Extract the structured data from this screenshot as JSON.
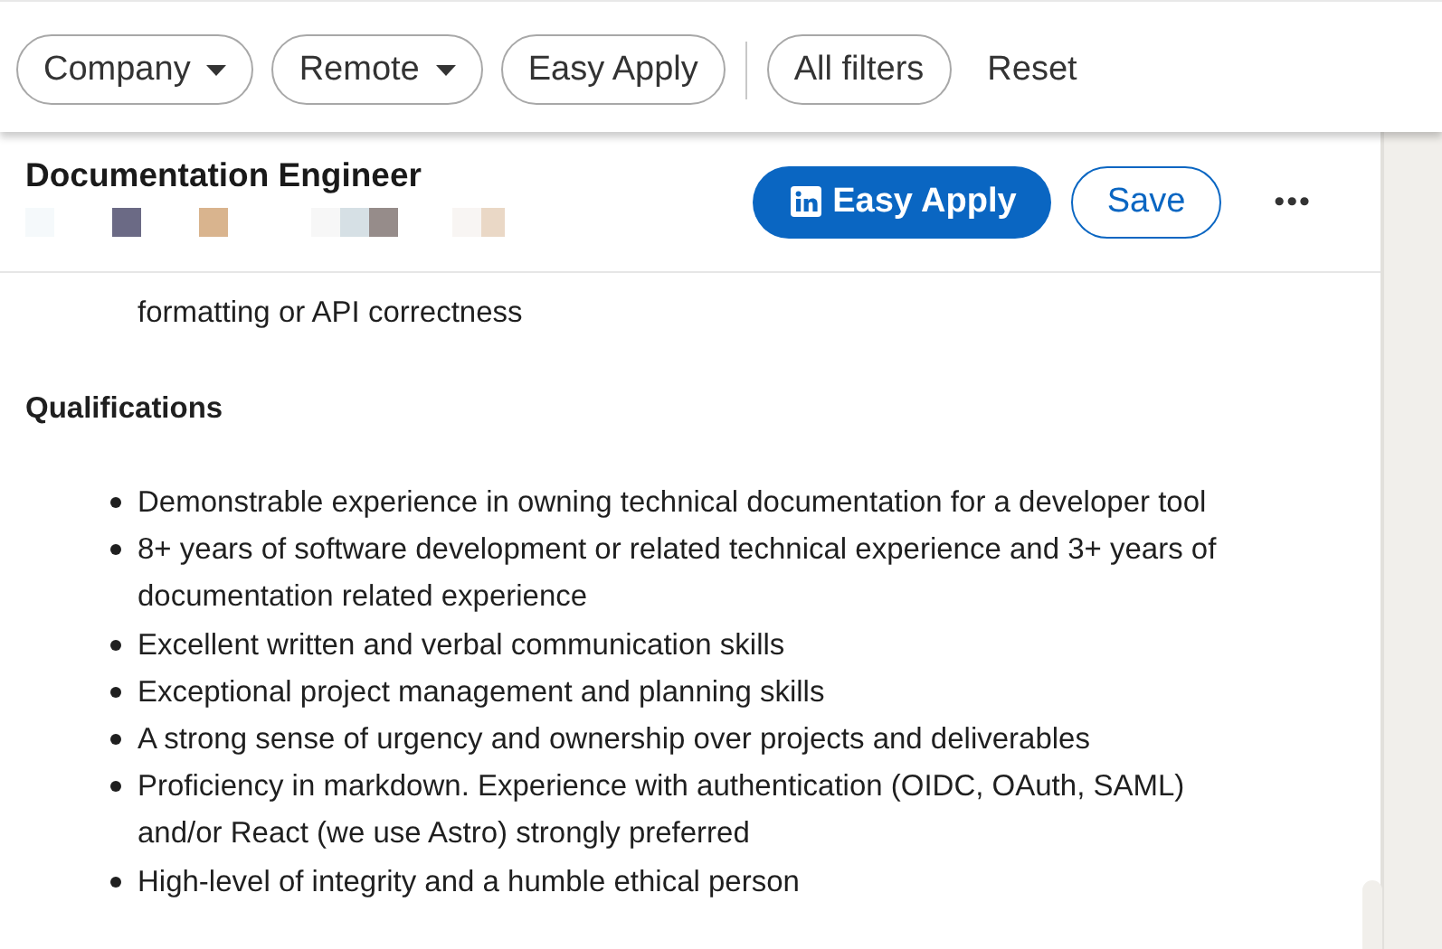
{
  "filters": [
    {
      "label": "Company",
      "dropdown": true
    },
    {
      "label": "Remote",
      "dropdown": true
    },
    {
      "label": "Easy Apply",
      "dropdown": false
    }
  ],
  "all_filters": "All filters",
  "reset": "Reset",
  "job": {
    "title": "Documentation Engineer",
    "apply_button": "Easy Apply",
    "save_button": "Save",
    "more": "•••"
  },
  "previous_item_tail": "formatting or API correctness",
  "section_heading": "Qualifications",
  "qualifications": [
    "Demonstrable experience in owning technical documentation for a developer tool",
    "8+ years of software development or related technical experience and 3+ years of documentation related experience",
    "Excellent written and verbal communication skills",
    "Exceptional project management and planning skills",
    "A strong sense of urgency and ownership over projects and deliverables",
    "Proficiency in markdown. Experience with authentication (OIDC, OAuth, SAML) and/or React (we use Astro) strongly preferred",
    "High-level of integrity and a humble ethical person"
  ]
}
